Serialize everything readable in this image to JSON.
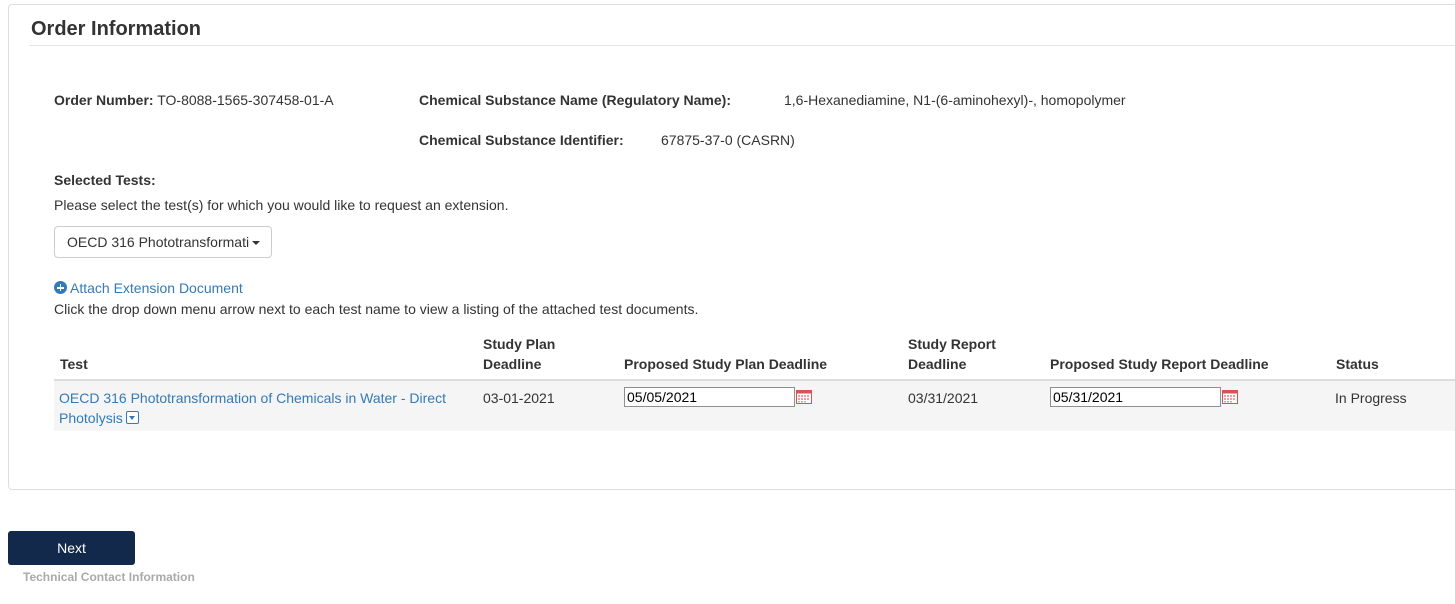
{
  "panel": {
    "title": "Order Information"
  },
  "order": {
    "number_label": "Order Number:",
    "number_value": "TO-8088-1565-307458-01-A",
    "chem_name_label": "Chemical Substance Name (Regulatory Name):",
    "chem_name_value": "1,6-Hexanediamine, N1-(6-aminohexyl)-, homopolymer",
    "chem_id_label": "Chemical Substance Identifier:",
    "chem_id_value": "67875-37-0 (CASRN)"
  },
  "tests": {
    "label": "Selected Tests:",
    "instruction": "Please select the test(s) for which you would like to request an extension.",
    "select_value": "OECD 316 Phototransformati",
    "attach_link": "Attach Extension Document",
    "dropdown_help": "Click the drop down menu arrow next to each test name to view a listing of the attached test documents."
  },
  "table": {
    "headers": {
      "test": "Test",
      "study_plan_deadline_1": "Study Plan",
      "study_plan_deadline_2": "Deadline",
      "proposed_plan": "Proposed Study Plan Deadline",
      "study_report_deadline_1": "Study Report",
      "study_report_deadline_2": "Deadline",
      "proposed_report": "Proposed Study Report Deadline",
      "status": "Status"
    },
    "rows": [
      {
        "test_line1": "OECD 316 Phototransformation of Chemicals in Water - Direct",
        "test_line2": "Photolysis",
        "study_plan_deadline": "03-01-2021",
        "proposed_plan_deadline": "05/05/2021",
        "study_report_deadline": "03/31/2021",
        "proposed_report_deadline": "05/31/2021",
        "status": "In Progress"
      }
    ]
  },
  "footer": {
    "next_label": "Next",
    "next_sub": "Technical Contact Information"
  },
  "colors": {
    "link": "#337ab7",
    "button": "#13294b",
    "row_bg": "#f5f5f5",
    "calendar": "#d9534f"
  },
  "icons": {
    "attach": "plus-circle-icon",
    "calendar": "calendar-icon",
    "documents_dropdown": "caret-square-down-icon"
  }
}
